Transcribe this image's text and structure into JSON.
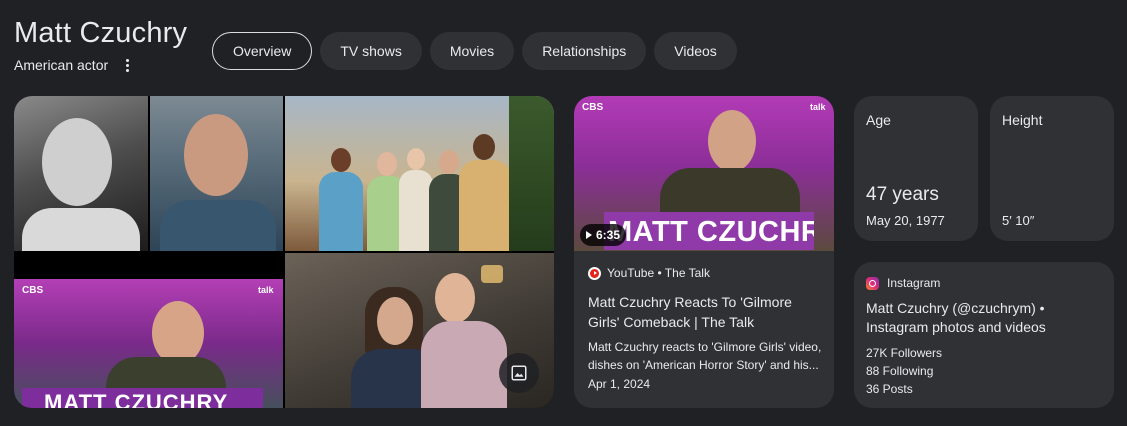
{
  "header": {
    "title": "Matt Czuchry",
    "subtitle": "American actor"
  },
  "tabs": [
    {
      "label": "Overview",
      "active": true
    },
    {
      "label": "TV shows",
      "active": false
    },
    {
      "label": "Movies",
      "active": false
    },
    {
      "label": "Relationships",
      "active": false
    },
    {
      "label": "Videos",
      "active": false
    }
  ],
  "images": {
    "banner_text": "MATT CZUCHRY",
    "network": "CBS",
    "talk_logo": "talk"
  },
  "video": {
    "duration": "6:35",
    "banner_text": "MATT CZUCHRY",
    "source": "YouTube • The Talk",
    "title": "Matt Czuchry Reacts To 'Gilmore Girls' Comeback | The Talk",
    "description": "Matt Czuchry reacts to 'Gilmore Girls' video, dishes on 'American Horror Story' and his...",
    "date": "Apr 1, 2024"
  },
  "facts": {
    "age": {
      "label": "Age",
      "value": "47 years",
      "sub": "May 20, 1977"
    },
    "height": {
      "label": "Height",
      "value": "",
      "sub": "5′ 10″"
    }
  },
  "instagram": {
    "source": "Instagram",
    "title": "Matt Czuchry (@czuchrym) • Instagram photos and videos",
    "followers": "27K Followers",
    "following": "88 Following",
    "posts": "36 Posts"
  },
  "colors": {
    "background": "#202124",
    "card": "#303134",
    "text": "#e8eaed",
    "accent_purple": "#8f3aa8"
  }
}
